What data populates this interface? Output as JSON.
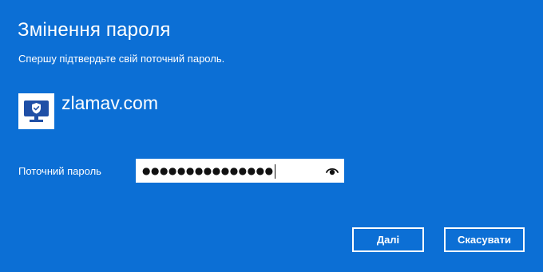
{
  "dialog": {
    "title": "Змінення пароля",
    "subtitle": "Спершу підтвердьте свій поточний пароль.",
    "account": {
      "icon": "monitor-shield-icon",
      "name": "zlamav.com"
    },
    "current_password": {
      "label": "Поточний пароль",
      "value": "●●●●●●●●●●●●●●●",
      "reveal_icon": "eye-icon"
    },
    "buttons": {
      "next": "Далі",
      "cancel": "Скасувати"
    }
  },
  "colors": {
    "background": "#0c6fd5",
    "accent_icon": "#1f4fa6",
    "text": "#ffffff"
  }
}
